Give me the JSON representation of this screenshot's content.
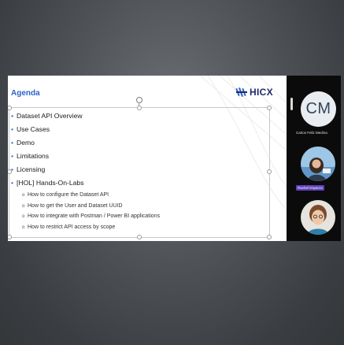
{
  "slide": {
    "title": "Agenda",
    "logo_text": "HICX",
    "bullets": [
      {
        "text": "Dataset API Overview",
        "sub": []
      },
      {
        "text": "Use Cases",
        "sub": []
      },
      {
        "text": "Demo",
        "sub": []
      },
      {
        "text": "Limitations",
        "sub": []
      },
      {
        "text": "Licensing",
        "sub": []
      },
      {
        "text": "[HOL] Hands-On-Labs",
        "sub": [
          "How to configure the Dataset API",
          "How to get the User and Dataset UUID",
          "How to integrate with Postman / Power BI applications",
          "How to restrict API access by scope"
        ]
      }
    ]
  },
  "participants": [
    {
      "initials": "CM",
      "name": "Carlos Feliz Medina"
    },
    {
      "name": "Rachel Esparza",
      "highlighted": true
    },
    {
      "name": ""
    }
  ],
  "colors": {
    "title_blue": "#2d63c8",
    "logo_navy": "#1d2a6b",
    "name_highlight": "#5b3fb8"
  }
}
